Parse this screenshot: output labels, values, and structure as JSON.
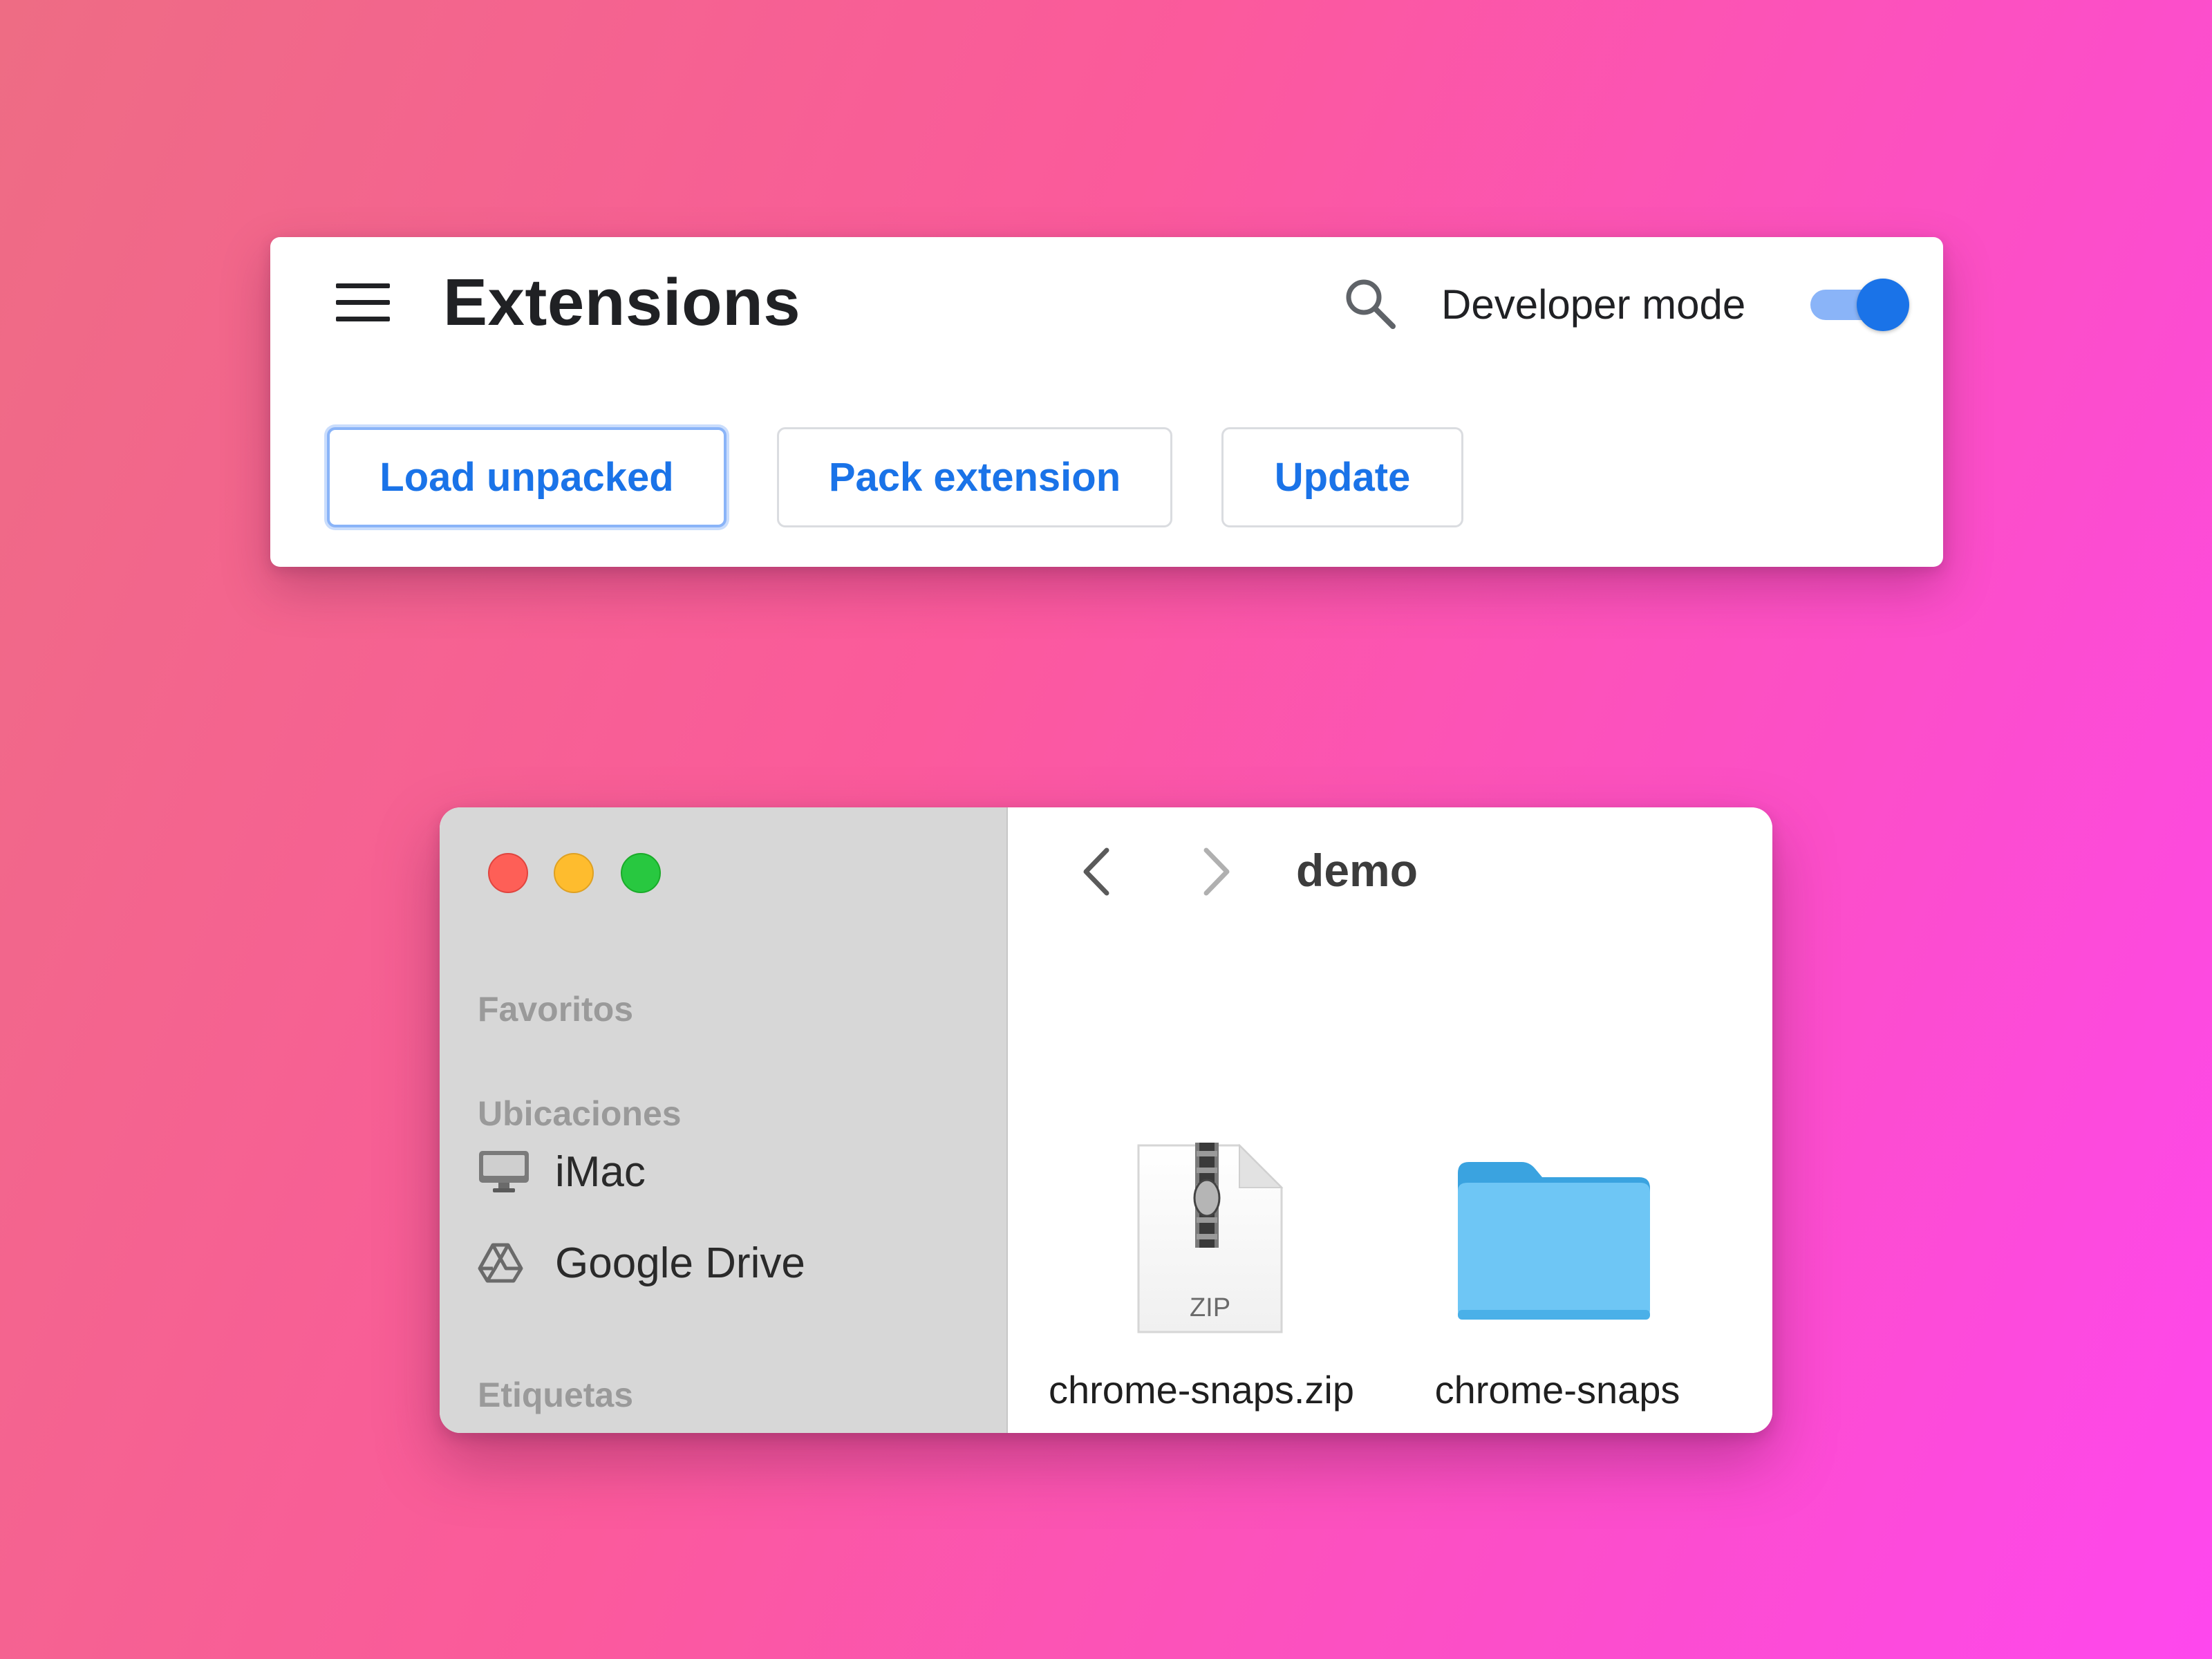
{
  "extensions": {
    "title": "Extensions",
    "developer_mode_label": "Developer mode",
    "developer_mode_enabled": true,
    "buttons": {
      "load_unpacked": "Load unpacked",
      "pack_extension": "Pack extension",
      "update": "Update"
    },
    "icons": [
      "menu-icon",
      "search-icon"
    ],
    "accent_color": "#1a73e8"
  },
  "finder": {
    "folder_title": "demo",
    "sidebar": {
      "favorites_heading": "Favoritos",
      "locations_heading": "Ubicaciones",
      "locations": [
        {
          "label": "iMac",
          "icon": "imac-icon"
        },
        {
          "label": "Google Drive",
          "icon": "google-drive-icon"
        }
      ],
      "tags_heading": "Etiquetas"
    },
    "files": [
      {
        "name": "chrome-snaps.zip",
        "icon": "zip-file-icon",
        "icon_text": "ZIP"
      },
      {
        "name": "chrome-snaps",
        "icon": "folder-icon"
      }
    ],
    "folder_color": "#6ec6f5"
  }
}
